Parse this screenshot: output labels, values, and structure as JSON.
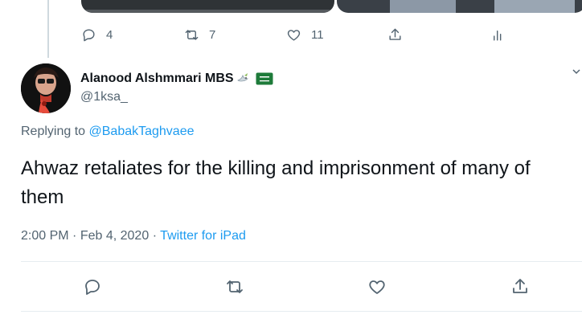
{
  "prev_tweet": {
    "reply_count": "4",
    "retweet_count": "7",
    "like_count": "11"
  },
  "tweet": {
    "display_name": "Alanood Alshmmari MBS",
    "handle": "@1ksa_",
    "replying_label": "Replying to",
    "replying_handle": "@BabakTaghvaee",
    "text": "Ahwaz retaliates for the killing and imprisonment of many of them",
    "time": "2:00 PM",
    "date": "Feb 4, 2020",
    "client": "Twitter for iPad",
    "sep": "·"
  },
  "icons": {
    "reply": "reply-icon",
    "retweet": "retweet-icon",
    "like": "like-icon",
    "share": "share-icon",
    "analytics": "analytics-icon",
    "dove": "dove-emoji-icon",
    "flag": "saudi-flag-icon",
    "more": "chevron-down-icon"
  },
  "colors": {
    "link": "#1d9bf0",
    "secondary_text": "#536471",
    "primary_text": "#0f1419",
    "divider": "#e6ecf0"
  }
}
